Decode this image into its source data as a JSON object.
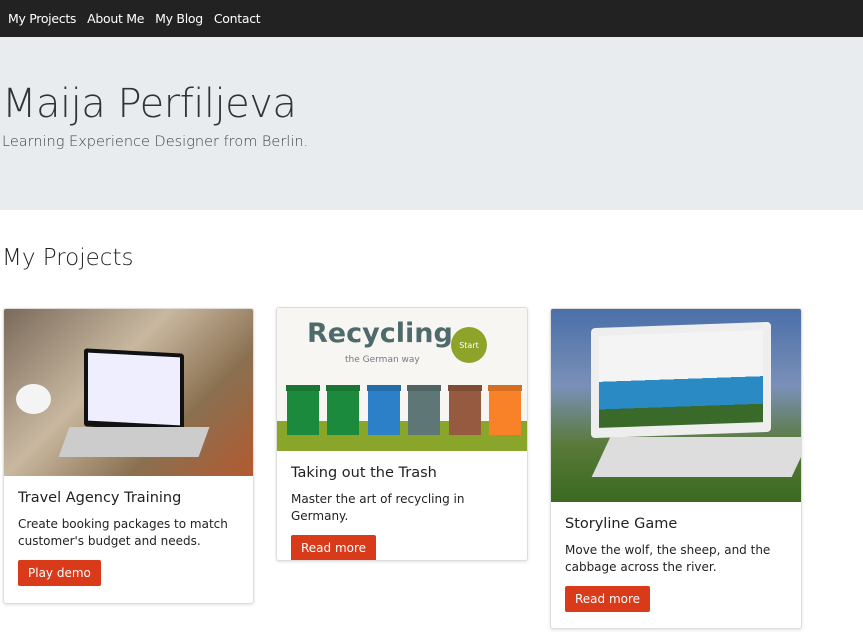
{
  "nav": {
    "items": [
      "My Projects",
      "About Me",
      "My Blog",
      "Contact"
    ]
  },
  "hero": {
    "title": "Maija Perfiljeva",
    "subtitle": "Learning Experience Designer from Berlin."
  },
  "section": {
    "title": "My Projects"
  },
  "projects": [
    {
      "title": "Travel Agency Training",
      "description": "Create booking packages to match customer's budget and needs.",
      "button": "Play demo"
    },
    {
      "title": "Taking out the Trash",
      "description": "Master the art of recycling in Germany.",
      "button": "Read more",
      "image_text": {
        "logo": "Recycling",
        "tagline": "the German way",
        "start": "Start"
      }
    },
    {
      "title": "Storyline Game",
      "description": "Move the wolf, the sheep, and the cabbage across the river.",
      "button": "Read more"
    }
  ],
  "colors": {
    "nav_bg": "#222222",
    "hero_bg": "#e9ecef",
    "button": "#d93a1a"
  }
}
